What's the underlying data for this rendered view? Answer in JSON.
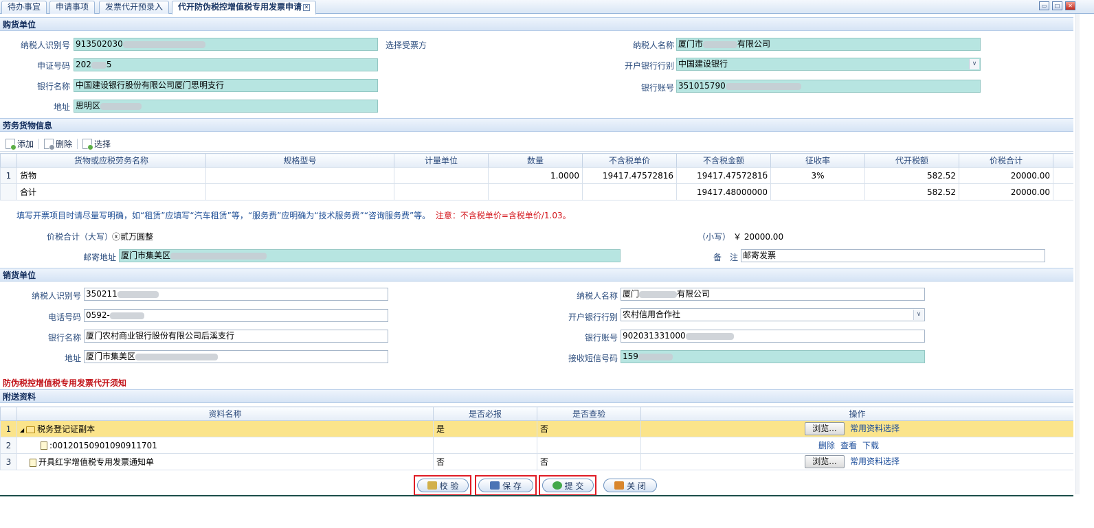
{
  "tabs": [
    {
      "label": "待办事宜"
    },
    {
      "label": "申请事项"
    },
    {
      "label": "发票代开预录入"
    },
    {
      "label": "代开防伪税控增值税专用发票申请"
    }
  ],
  "buyer": {
    "title": "购货单位",
    "taxpayer_id_label": "纳税人识别号",
    "taxpayer_id": "913502030",
    "select_drawer": "选择受票方",
    "name_label": "纳税人名称",
    "name_prefix": "厦门市",
    "name_suffix": "有限公司",
    "cert_label": "申证号码",
    "cert": "202",
    "cert_tail": "5",
    "bank_type_label": "开户银行行别",
    "bank_type": "中国建设银行",
    "bank_name_label": "银行名称",
    "bank_name": "中国建设银行股份有限公司厦门思明支行",
    "account_label": "银行账号",
    "account": "351015790",
    "address_label": "地址",
    "address": "思明区"
  },
  "goods": {
    "title": "劳务货物信息",
    "toolbar": {
      "add": "添加",
      "delete": "删除",
      "select": "选择"
    },
    "columns": [
      "货物或应税劳务名称",
      "规格型号",
      "计量单位",
      "数量",
      "不含税单价",
      "不含税金额",
      "征收率",
      "代开税额",
      "价税合计"
    ],
    "rows": [
      {
        "no": "1",
        "name": "货物",
        "spec": "",
        "unit": "",
        "qty": "1.0000",
        "price": "19417.47572816",
        "amount": "19417.4757281б",
        "rate": "3%",
        "tax": "582.52",
        "total": "20000.00"
      },
      {
        "no": "",
        "name": "合计",
        "spec": "",
        "unit": "",
        "qty": "",
        "price": "",
        "amount": "19417.48000000",
        "rate": "",
        "tax": "582.52",
        "total": "20000.00"
      }
    ],
    "note": "填写开票项目时请尽量写明确，如“租赁”应填写“汽车租赁”等，“服务费”应明确为“技术服务费”“咨询服务费”等。",
    "note_red": "注意：不含税单价=含税单价/1.03。",
    "total_upper_label": "价税合计（大写）",
    "total_upper": "ⓧ贰万圆整",
    "total_lower_label": "（小写）",
    "total_lower": "￥ 20000.00",
    "mail_label": "邮寄地址",
    "mail": "厦门市集美区",
    "remark_label": "备　注",
    "remark": "邮寄发票"
  },
  "seller": {
    "title": "销货单位",
    "taxpayer_id_label": "纳税人识别号",
    "taxpayer_id": "350211",
    "name_label": "纳税人名称",
    "name_prefix": "厦门",
    "name_suffix": "有限公司",
    "phone_label": "电话号码",
    "phone": "0592-",
    "bank_type_label": "开户银行行别",
    "bank_type": "农村信用合作社",
    "bank_name_label": "银行名称",
    "bank_name": "厦门农村商业银行股份有限公司后溪支行",
    "account_label": "银行账号",
    "account": "902031331000",
    "address_label": "地址",
    "address": "厦门市集美区",
    "sms_label": "接收短信号码",
    "sms": "159"
  },
  "notice_title": "防伪税控增值税专用发票代开须知",
  "attachments": {
    "title": "附送资料",
    "columns": [
      "资料名称",
      "是否必报",
      "是否查验",
      "操作"
    ],
    "rows": [
      {
        "no": "1",
        "name": "税务登记证副本",
        "required": "是",
        "verified": "否",
        "browse": "浏览...",
        "common": "常用资料选择"
      },
      {
        "no": "2",
        "name": ":00120150901090911701",
        "required": "",
        "verified": "",
        "delete": "删除",
        "view": "查看",
        "download": "下载"
      },
      {
        "no": "3",
        "name": "开具红字增值税专用发票通知单",
        "required": "否",
        "verified": "否",
        "browse": "浏览...",
        "common": "常用资料选择"
      }
    ]
  },
  "actions": {
    "validate": "校 验",
    "save": "保 存",
    "submit": "提 交",
    "close": "关 闭"
  }
}
